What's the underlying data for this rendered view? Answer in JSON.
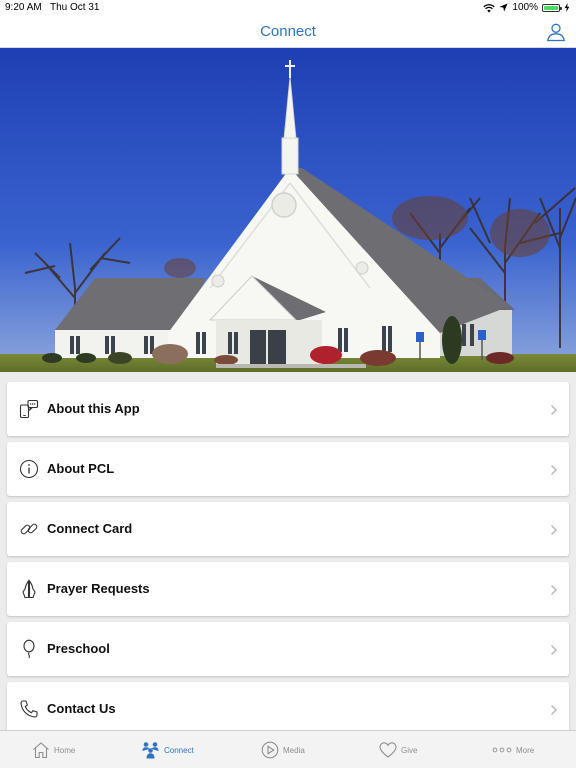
{
  "status": {
    "time": "9:20 AM",
    "date": "Thu Oct 31",
    "battery_text": "100%",
    "battery_level": 1.0
  },
  "nav": {
    "title": "Connect",
    "profile_icon": "person-icon"
  },
  "hero": {
    "image": "church-photo"
  },
  "menu": [
    {
      "label": "About this App",
      "icon": "phone-chat-icon"
    },
    {
      "label": "About PCL",
      "icon": "info-icon"
    },
    {
      "label": "Connect Card",
      "icon": "link-icon"
    },
    {
      "label": "Prayer Requests",
      "icon": "praying-hands-icon"
    },
    {
      "label": "Preschool",
      "icon": "balloon-icon"
    },
    {
      "label": "Contact Us",
      "icon": "phone-icon"
    }
  ],
  "tabs": [
    {
      "label": "Home",
      "icon": "home-icon",
      "active": false
    },
    {
      "label": "Connect",
      "icon": "people-icon",
      "active": true
    },
    {
      "label": "Media",
      "icon": "play-icon",
      "active": false
    },
    {
      "label": "Give",
      "icon": "heart-icon",
      "active": false
    },
    {
      "label": "More",
      "icon": "more-dots-icon",
      "active": false
    }
  ],
  "colors": {
    "accent": "#2f74c0",
    "inactive_tab": "#8e8e8e",
    "sky": "#2f55c9",
    "background": "#ececec"
  }
}
